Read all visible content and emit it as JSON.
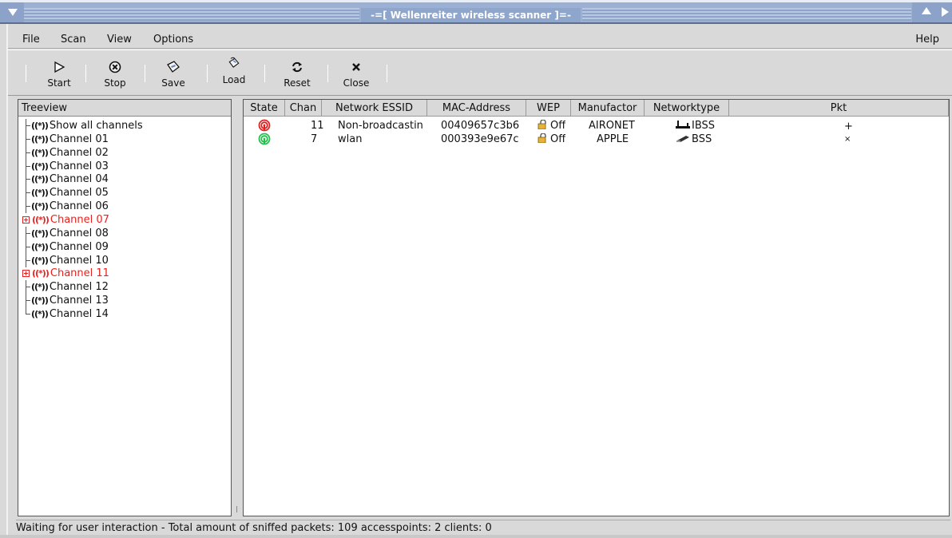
{
  "window": {
    "title": "-=[ Wellenreiter wireless scanner ]=-"
  },
  "menubar": {
    "file": "File",
    "scan": "Scan",
    "view": "View",
    "options": "Options",
    "help": "Help"
  },
  "toolbar": {
    "start": "Start",
    "stop": "Stop",
    "save": "Save",
    "load": "Load",
    "reset": "Reset",
    "close": "Close"
  },
  "treeview": {
    "header": "Treeview",
    "items": [
      {
        "label": "Show all channels",
        "expanded": false
      },
      {
        "label": "Channel 01"
      },
      {
        "label": "Channel 02"
      },
      {
        "label": "Channel 03"
      },
      {
        "label": "Channel 04"
      },
      {
        "label": "Channel 05"
      },
      {
        "label": "Channel 06"
      },
      {
        "label": "Channel 07",
        "active": true
      },
      {
        "label": "Channel 08"
      },
      {
        "label": "Channel 09"
      },
      {
        "label": "Channel 10"
      },
      {
        "label": "Channel 11",
        "active": true
      },
      {
        "label": "Channel 12"
      },
      {
        "label": "Channel 13"
      },
      {
        "label": "Channel 14"
      }
    ],
    "antenna_glyph": "((*))"
  },
  "table": {
    "columns": [
      "State",
      "Chan",
      "Network ESSID",
      "MAC-Address",
      "WEP",
      "Manufactor",
      "Networktype",
      "Pkt"
    ],
    "rows": [
      {
        "state": "red",
        "chan": "11",
        "essid": "Non-broadcastin",
        "mac": "00409657c3b6",
        "wep": "Off",
        "manufactor": "AIRONET",
        "networktype": "IBSS",
        "pkt": "+"
      },
      {
        "state": "green",
        "chan": "7",
        "essid": "wlan",
        "mac": "000393e9e67c",
        "wep": "Off",
        "manufactor": "APPLE",
        "networktype": "BSS",
        "pkt": "×"
      }
    ]
  },
  "status": {
    "text": "Waiting for user interaction - Total amount of sniffed packets: 109   accesspoints: 2 clients: 0"
  },
  "colors": {
    "active_channel": "#e8221e",
    "state_red": "#e02222",
    "state_green": "#22c04a",
    "titlebar": "#9bb0d2"
  }
}
